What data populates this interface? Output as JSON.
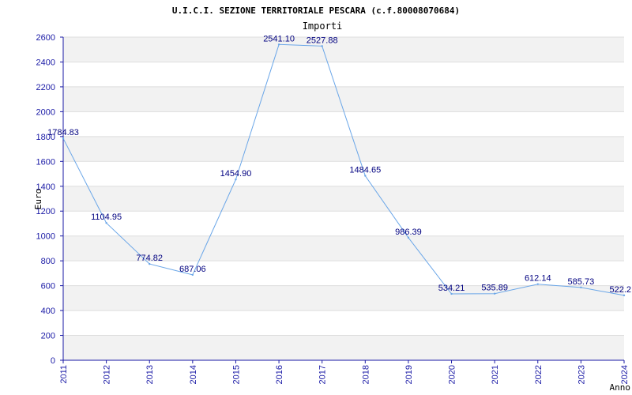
{
  "colors": {
    "line": "#6aa6e8",
    "band": "#f2f2f2",
    "grid": "#dddddd",
    "axis": "#1a1aa6",
    "tick_text": "#1a1aa6",
    "data_label": "#000080"
  },
  "chart_data": {
    "type": "line",
    "title": "U.I.C.I. SEZIONE TERRITORIALE PESCARA (c.f.80008070684)",
    "subtitle": "Importi",
    "xlabel": "Anno",
    "ylabel": "Euro",
    "x": [
      "2011",
      "2012",
      "2013",
      "2014",
      "2015",
      "2016",
      "2017",
      "2018",
      "2019",
      "2020",
      "2021",
      "2022",
      "2023",
      "2024"
    ],
    "values": [
      1784.83,
      1104.95,
      774.82,
      687.06,
      1454.9,
      2541.1,
      2527.88,
      1484.65,
      986.39,
      534.21,
      535.89,
      612.14,
      585.73,
      522.2
    ],
    "data_labels": [
      "1784.83",
      "1104.95",
      "774.82",
      "687.06",
      "1454.90",
      "2541.10",
      "2527.88",
      "1484.65",
      "986.39",
      "534.21",
      "535.89",
      "612.14",
      "585.73",
      "522.2"
    ],
    "ylim": [
      0,
      2600
    ],
    "yticks": [
      "0",
      "200",
      "400",
      "600",
      "800",
      "1000",
      "1200",
      "1400",
      "1600",
      "1800",
      "2000",
      "2200",
      "2400",
      "2600"
    ],
    "grid": true,
    "legend": "none"
  }
}
